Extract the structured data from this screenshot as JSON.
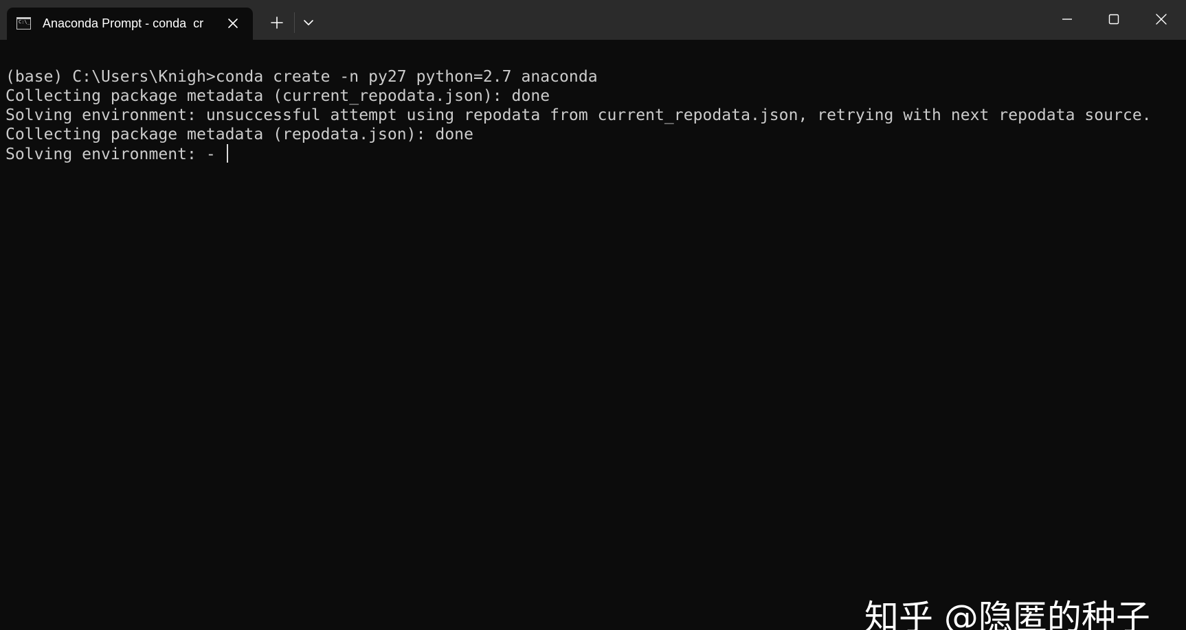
{
  "tab": {
    "title": "Anaconda Prompt - conda  cr",
    "icon": "terminal-icon",
    "icon_glyph": "C:\\_"
  },
  "titlebar": {
    "background": "#2b2b2b",
    "icons": [
      "close-icon",
      "plus-icon",
      "chevron-down-icon",
      "minimize-icon",
      "maximize-icon",
      "close-icon"
    ]
  },
  "terminal": {
    "background": "#0c0c0c",
    "foreground": "#cccccc",
    "lines": [
      "(base) C:\\Users\\Knigh>conda create -n py27 python=2.7 anaconda",
      "Collecting package metadata (current_repodata.json): done",
      "Solving environment: unsuccessful attempt using repodata from current_repodata.json, retrying with next repodata source.",
      "Collecting package metadata (repodata.json): done",
      "Solving environment: - "
    ]
  },
  "watermark": {
    "text": "知乎 @隐匿的种子"
  }
}
